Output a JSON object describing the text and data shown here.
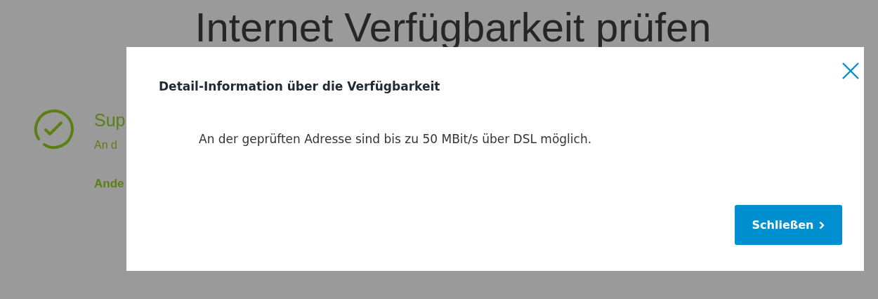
{
  "page": {
    "title": "Internet Verfügbarkeit prüfen",
    "result": {
      "heading": "Sup",
      "text": "An d",
      "link": "Ande"
    }
  },
  "dialog": {
    "title": "Detail-Information über die Verfügbarkeit",
    "message": "An der geprüften Adresse sind bis zu 50 MBit/s über DSL möglich.",
    "button": "Schließen"
  }
}
